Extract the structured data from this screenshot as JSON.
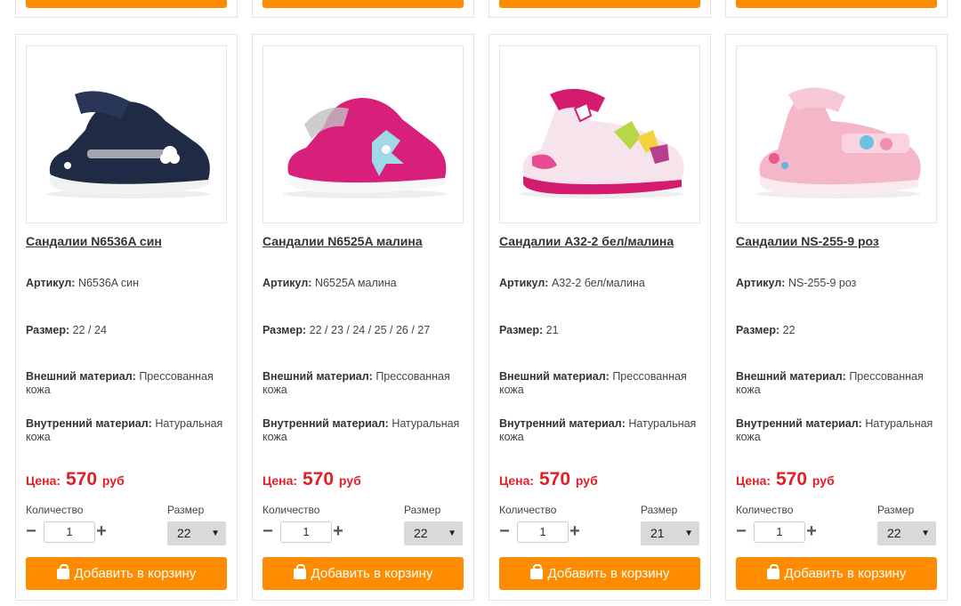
{
  "colors": {
    "accent": "#ff8c00",
    "price": "#e31e24",
    "button_text": "#ffffff"
  },
  "labels": {
    "article": "Артикул:",
    "size": "Размер:",
    "outer": "Внешний материал:",
    "inner": "Внутренний материал:",
    "price": "Цена:",
    "currency": "руб",
    "qty_label": "Количество",
    "size_label": "Размер",
    "add_to_cart": "Добавить в корзину",
    "minus": "−",
    "plus": "+",
    "select_arrow": "▼"
  },
  "products": [
    {
      "name": "Сандалии N6536A син",
      "article": "N6536A син",
      "sizes": "22 / 24",
      "outer": "Прессованная кожа",
      "inner": "Натуральная кожа",
      "price": "570",
      "qty": "1",
      "selected_size": "22",
      "image": "navy-blue-sandal"
    },
    {
      "name": "Сандалии N6525A малина",
      "article": "N6525A малина",
      "sizes": "22 / 23 / 24 / 25 / 26 / 27",
      "outer": "Прессованная кожа",
      "inner": "Натуральная кожа",
      "price": "570",
      "qty": "1",
      "selected_size": "22",
      "image": "raspberry-sandal"
    },
    {
      "name": "Сандалии A32-2 бел/малина",
      "article": "A32-2 бел/малина",
      "sizes": "21",
      "outer": "Прессованная кожа",
      "inner": "Натуральная кожа",
      "price": "570",
      "qty": "1",
      "selected_size": "21",
      "image": "white-raspberry-sandal"
    },
    {
      "name": "Сандалии NS-255-9 роз",
      "article": "NS-255-9 роз",
      "sizes": "22",
      "outer": "Прессованная кожа",
      "inner": "Натуральная кожа",
      "price": "570",
      "qty": "1",
      "selected_size": "22",
      "image": "pink-sandal"
    }
  ]
}
